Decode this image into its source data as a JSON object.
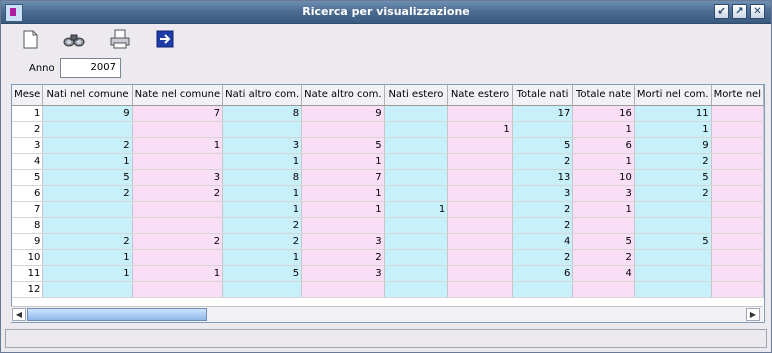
{
  "window": {
    "title": "Ricerca per visualizzazione"
  },
  "toolbar": {
    "buttons": [
      {
        "name": "new-document-icon"
      },
      {
        "name": "binoculars-icon"
      },
      {
        "name": "printer-icon"
      },
      {
        "name": "exit-arrow-icon"
      }
    ]
  },
  "filter": {
    "anno_label": "Anno",
    "anno_value": "2007"
  },
  "table": {
    "columns": [
      "Mese",
      "Nati nel comune",
      "Nate nel comune",
      "Nati altro com.",
      "Nate altro com.",
      "Nati estero",
      "Nate estero",
      "Totale nati",
      "Totale nate",
      "Morti nel com.",
      "Morte nel"
    ],
    "rows": [
      [
        "1",
        "9",
        "7",
        "8",
        "9",
        "",
        "",
        "17",
        "16",
        "11",
        ""
      ],
      [
        "2",
        "",
        "",
        "",
        "",
        "",
        "1",
        "",
        "1",
        "1",
        ""
      ],
      [
        "3",
        "2",
        "1",
        "3",
        "5",
        "",
        "",
        "5",
        "6",
        "9",
        ""
      ],
      [
        "4",
        "1",
        "",
        "1",
        "1",
        "",
        "",
        "2",
        "1",
        "2",
        ""
      ],
      [
        "5",
        "5",
        "3",
        "8",
        "7",
        "",
        "",
        "13",
        "10",
        "5",
        ""
      ],
      [
        "6",
        "2",
        "2",
        "1",
        "1",
        "",
        "",
        "3",
        "3",
        "2",
        ""
      ],
      [
        "7",
        "",
        "",
        "1",
        "1",
        "1",
        "",
        "2",
        "1",
        "",
        ""
      ],
      [
        "8",
        "",
        "",
        "2",
        "",
        "",
        "",
        "2",
        "",
        "",
        ""
      ],
      [
        "9",
        "2",
        "2",
        "2",
        "3",
        "",
        "",
        "4",
        "5",
        "5",
        ""
      ],
      [
        "10",
        "1",
        "",
        "1",
        "2",
        "",
        "",
        "2",
        "2",
        "",
        ""
      ],
      [
        "11",
        "1",
        "1",
        "5",
        "3",
        "",
        "",
        "6",
        "4",
        "",
        ""
      ],
      [
        "12",
        "",
        "",
        "",
        "",
        "",
        "",
        "",
        "",
        "",
        ""
      ]
    ]
  },
  "colors": {
    "blue_col": "#c8f0fa",
    "pink_col": "#f9def6",
    "title_bar": "#4d6d93"
  }
}
